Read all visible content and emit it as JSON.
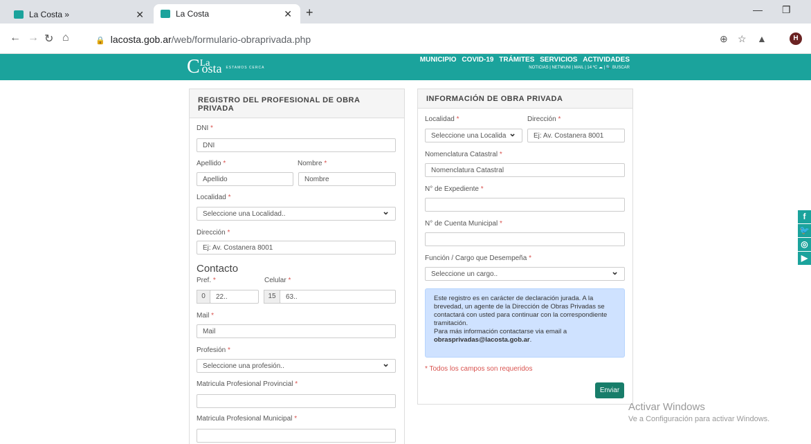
{
  "browser": {
    "tabs": [
      {
        "title": "La Costa »",
        "active": false
      },
      {
        "title": "La Costa",
        "active": true
      }
    ],
    "url": {
      "host": "lacosta.gob.ar",
      "path": "/web/formulario-obraprivada.php"
    },
    "avatar": "H"
  },
  "site": {
    "logo": {
      "big": "C",
      "small": "La",
      "rest": "osta",
      "tagline": "ESTAMOS CERCA"
    },
    "nav": [
      "MUNICIPIO",
      "COVID-19",
      "TRÁMITES",
      "SERVICIOS",
      "ACTIVIDADES"
    ],
    "subnav": "NOTICIAS | NETMUNI | MAIL | 14 ºC ☁ | 🔍 BUSCAR"
  },
  "left_panel": {
    "title": "REGISTRO DEL PROFESIONAL DE OBRA PRIVADA",
    "dni_label": "DNI",
    "dni_placeholder": "DNI",
    "apellido_label": "Apellido",
    "apellido_placeholder": "Apellido",
    "nombre_label": "Nombre",
    "nombre_placeholder": "Nombre",
    "localidad_label": "Localidad",
    "localidad_value": "Seleccione una Localidad..",
    "direccion_label": "Dirección",
    "direccion_placeholder": "Ej: Av. Costanera 8001",
    "contacto_heading": "Contacto",
    "pref_label": "Pref.",
    "pref_addon": "0",
    "pref_placeholder": "22..",
    "celular_label": "Celular",
    "celular_addon": "15",
    "celular_placeholder": "63..",
    "mail_label": "Mail",
    "mail_placeholder": "Mail",
    "profesion_label": "Profesión",
    "profesion_value": "Seleccione una profesión..",
    "mat_prov_label": "Matricula Profesional Provincial",
    "mat_mun_label": "Matricula Profesional Municipal"
  },
  "right_panel": {
    "title": "INFORMACIÓN DE OBRA PRIVADA",
    "localidad_label": "Localidad",
    "localidad_value": "Seleccione una Localida",
    "direccion_label": "Dirección",
    "direccion_placeholder": "Ej: Av. Costanera 8001",
    "nomenclatura_label": "Nomenclatura Catastral",
    "nomenclatura_placeholder": "Nomenclatura Catastral",
    "expediente_label": "N° de Expediente",
    "cuenta_label": "N° de Cuenta Municipal",
    "funcion_label": "Función / Cargo que Desempeña",
    "funcion_value": "Seleccione un cargo..",
    "alert_text": "Este registro es en carácter de declaración jurada. A la brevedad, un agente de la Dirección de Obras Privadas se contactará con usted para continuar con la correspondiente tramitación.",
    "alert_more": "Para más información contactarse via email a",
    "alert_email": "obrasprivadas@lacosta.gob.ar",
    "required_note": "* Todos los campos son requeridos",
    "submit_label": "Enviar"
  },
  "social": [
    "f",
    "t",
    "ig",
    "yt"
  ],
  "watermark": {
    "line1": "Activar Windows",
    "line2": "Ve a Configuración para activar Windows."
  }
}
